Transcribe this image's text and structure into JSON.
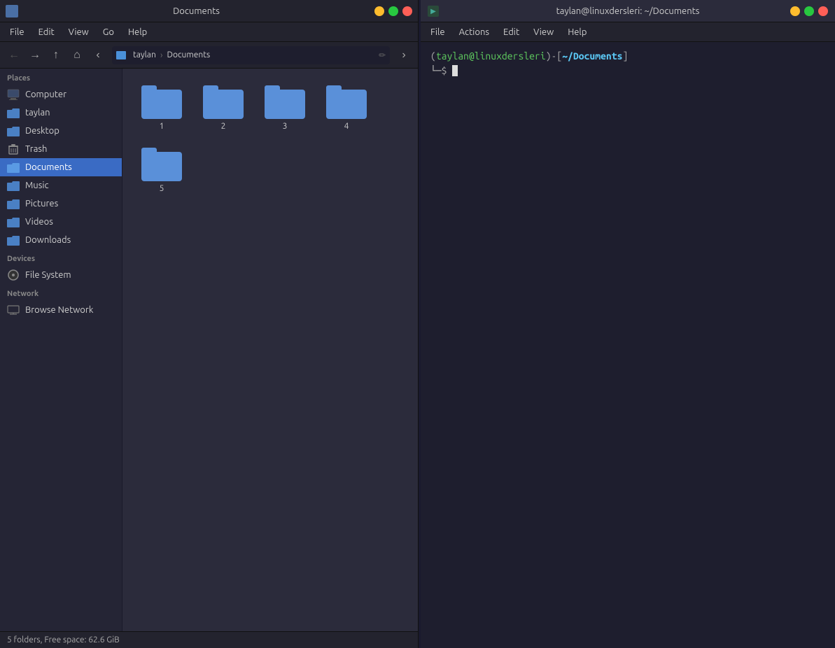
{
  "filemanager": {
    "title": "Documents",
    "icon_label": "FM",
    "menubar": [
      "File",
      "Edit",
      "View",
      "Go",
      "Help"
    ],
    "breadcrumb": {
      "home_label": "taylan",
      "current_label": "Documents"
    },
    "sidebar": {
      "places_label": "Places",
      "items": [
        {
          "id": "computer",
          "label": "Computer",
          "icon": "computer"
        },
        {
          "id": "taylan",
          "label": "taylan",
          "icon": "folder"
        },
        {
          "id": "desktop",
          "label": "Desktop",
          "icon": "folder"
        },
        {
          "id": "trash",
          "label": "Trash",
          "icon": "trash"
        },
        {
          "id": "documents",
          "label": "Documents",
          "icon": "folder",
          "active": true
        },
        {
          "id": "music",
          "label": "Music",
          "icon": "folder"
        },
        {
          "id": "pictures",
          "label": "Pictures",
          "icon": "folder"
        },
        {
          "id": "videos",
          "label": "Videos",
          "icon": "folder"
        },
        {
          "id": "downloads",
          "label": "Downloads",
          "icon": "folder"
        }
      ],
      "devices_label": "Devices",
      "devices": [
        {
          "id": "filesystem",
          "label": "File System",
          "icon": "filesystem"
        }
      ],
      "network_label": "Network",
      "network_items": [
        {
          "id": "browse-network",
          "label": "Browse Network",
          "icon": "network"
        }
      ]
    },
    "folders": [
      {
        "label": "1"
      },
      {
        "label": "2"
      },
      {
        "label": "3"
      },
      {
        "label": "4"
      },
      {
        "label": "5"
      }
    ],
    "statusbar": "5 folders, Free space: 62.6 GiB"
  },
  "terminal": {
    "title": "taylan@linuxdersleri: ~/Documents",
    "menubar": [
      "File",
      "Actions",
      "Edit",
      "View",
      "Help"
    ],
    "prompt": {
      "user": "taylan",
      "host": "linuxdersleri",
      "path": "~/Documents"
    }
  }
}
